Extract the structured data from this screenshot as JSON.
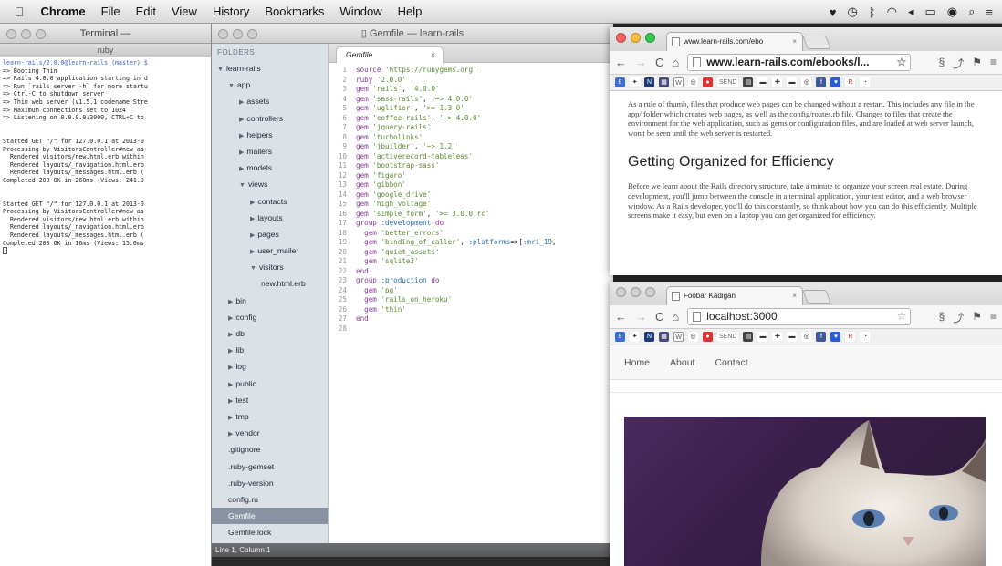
{
  "menubar": {
    "items": [
      {
        "label": "Chrome"
      },
      {
        "label": "File"
      },
      {
        "label": "Edit"
      },
      {
        "label": "View"
      },
      {
        "label": "History"
      },
      {
        "label": "Bookmarks"
      },
      {
        "label": "Window"
      },
      {
        "label": "Help"
      }
    ]
  },
  "terminal": {
    "title": "Terminal —",
    "tab": "ruby",
    "lines": [
      "learn-rails/2.0.0@learn-rails (master) $",
      "=> Booting Thin",
      "=> Rails 4.0.0 application starting in d",
      "=> Run `rails server -h` for more startu",
      "=> Ctrl-C to shutdown server",
      "=> Thin web server (v1.5.1 codename Stre",
      "=> Maximum connections set to 1024",
      "=> Listening on 0.0.0.0:3000, CTRL+C to",
      "",
      "",
      "Started GET \"/\" for 127.0.0.1 at 2013-0",
      "Processing by VisitorsController#new as",
      "  Rendered visitors/new.html.erb within",
      "  Rendered layouts/_navigation.html.erb",
      "  Rendered layouts/_messages.html.erb (",
      "Completed 200 OK in 268ms (Views: 241.9",
      "",
      "",
      "Started GET \"/\" for 127.0.0.1 at 2013-0",
      "Processing by VisitorsController#new as",
      "  Rendered visitors/new.html.erb within",
      "  Rendered layouts/_navigation.html.erb",
      "  Rendered layouts/_messages.html.erb (",
      "Completed 200 OK in 16ms (Views: 15.0ms"
    ]
  },
  "sublime": {
    "title": "Gemfile — learn-rails",
    "folders_label": "FOLDERS",
    "tree": [
      {
        "label": "learn-rails",
        "depth": 0,
        "arrow": "open"
      },
      {
        "label": "app",
        "depth": 1,
        "arrow": "open"
      },
      {
        "label": "assets",
        "depth": 2,
        "arrow": "closed"
      },
      {
        "label": "controllers",
        "depth": 2,
        "arrow": "closed"
      },
      {
        "label": "helpers",
        "depth": 2,
        "arrow": "closed"
      },
      {
        "label": "mailers",
        "depth": 2,
        "arrow": "closed"
      },
      {
        "label": "models",
        "depth": 2,
        "arrow": "closed"
      },
      {
        "label": "views",
        "depth": 2,
        "arrow": "open"
      },
      {
        "label": "contacts",
        "depth": 3,
        "arrow": "closed"
      },
      {
        "label": "layouts",
        "depth": 3,
        "arrow": "closed"
      },
      {
        "label": "pages",
        "depth": 3,
        "arrow": "closed"
      },
      {
        "label": "user_mailer",
        "depth": 3,
        "arrow": "closed"
      },
      {
        "label": "visitors",
        "depth": 3,
        "arrow": "open"
      },
      {
        "label": "new.html.erb",
        "depth": 4,
        "arrow": "none"
      },
      {
        "label": "bin",
        "depth": 1,
        "arrow": "closed"
      },
      {
        "label": "config",
        "depth": 1,
        "arrow": "closed"
      },
      {
        "label": "db",
        "depth": 1,
        "arrow": "closed"
      },
      {
        "label": "lib",
        "depth": 1,
        "arrow": "closed"
      },
      {
        "label": "log",
        "depth": 1,
        "arrow": "closed"
      },
      {
        "label": "public",
        "depth": 1,
        "arrow": "closed"
      },
      {
        "label": "test",
        "depth": 1,
        "arrow": "closed"
      },
      {
        "label": "tmp",
        "depth": 1,
        "arrow": "closed"
      },
      {
        "label": "vendor",
        "depth": 1,
        "arrow": "closed"
      },
      {
        "label": ".gitignore",
        "depth": 1,
        "arrow": "none"
      },
      {
        "label": ".ruby-gemset",
        "depth": 1,
        "arrow": "none"
      },
      {
        "label": ".ruby-version",
        "depth": 1,
        "arrow": "none"
      },
      {
        "label": "config.ru",
        "depth": 1,
        "arrow": "none"
      },
      {
        "label": "Gemfile",
        "depth": 1,
        "arrow": "none",
        "selected": true
      },
      {
        "label": "Gemfile.lock",
        "depth": 1,
        "arrow": "none"
      },
      {
        "label": "Rakefile",
        "depth": 1,
        "arrow": "none"
      },
      {
        "label": "README",
        "depth": 1,
        "arrow": "none"
      },
      {
        "label": "README.textile",
        "depth": 1,
        "arrow": "none"
      }
    ],
    "tab_label": "Gemfile",
    "tab_close": "×",
    "code": [
      "source 'https://rubygems.org'",
      "ruby '2.0.0'",
      "gem 'rails', '4.0.0'",
      "gem 'sass-rails', '~> 4.0.0'",
      "gem 'uglifier', '>= 1.3.0'",
      "gem 'coffee-rails', '~> 4.0.0'",
      "gem 'jquery-rails'",
      "gem 'turbolinks'",
      "gem 'jbuilder', '~> 1.2'",
      "gem 'activerecord-tableless'",
      "gem 'bootstrap-sass'",
      "gem 'figaro'",
      "gem 'gibbon'",
      "gem 'google_drive'",
      "gem 'high_voltage'",
      "gem 'simple_form', '>= 3.0.0.rc'",
      "group :development do",
      "  gem 'better_errors'",
      "  gem 'binding_of_caller', :platforms=>[:mri_19,",
      "  gem 'quiet_assets'",
      "  gem 'sqlite3'",
      "end",
      "group :production do",
      "  gem 'pg'",
      "  gem 'rails_on_heroku'",
      "  gem 'thin'",
      "end",
      ""
    ],
    "status": "Line 1, Column 1"
  },
  "ebook_window": {
    "tab_title": "www.learn-rails.com/ebo",
    "tab_close": "×",
    "url": "www.learn-rails.com/ebooks/l...",
    "bookmarks": [
      "8",
      "N",
      "W",
      "SEND",
      "R"
    ],
    "para1": "As a rule of thumb, files that produce web pages can be changed without a restart. This includes any file in the app/ folder which creates web pages, as well as the config/routes.rb file. Changes to files that create the environment for the web application, such as gems or configuration files, and are loaded at web server launch, won't be seen until the web server is restarted.",
    "heading": "Getting Organized for Efficiency",
    "para2": "Before we learn about the Rails directory structure, take a minute to organize your screen real estate. During development, you'll jump between the console in a terminal application, your text editor, and a web browser window. As a Rails developer, you'll do this constantly, so think about how you can do this efficiently. Multiple screens make it easy, but even on a laptop you can get organized for efficiency."
  },
  "local_window": {
    "tab_title": "Foobar Kadigan",
    "tab_close": "×",
    "url": "localhost:3000",
    "nav": [
      {
        "label": "Home"
      },
      {
        "label": "About"
      },
      {
        "label": "Contact"
      }
    ]
  },
  "icons": [
    "apple-icon",
    "back-arrow-icon",
    "forward-arrow-icon",
    "reload-icon",
    "home-icon",
    "bookmark-star-icon",
    "menu-icon",
    "wifi-icon",
    "search-icon",
    "battery-icon"
  ]
}
